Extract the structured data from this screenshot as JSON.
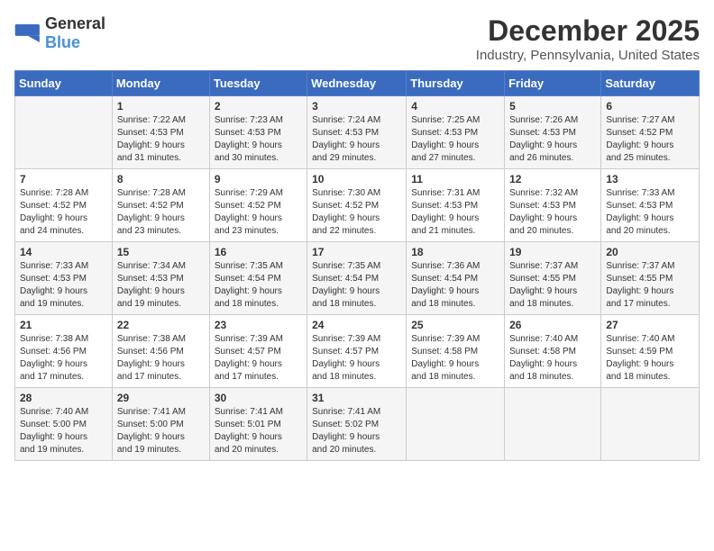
{
  "header": {
    "logo_general": "General",
    "logo_blue": "Blue",
    "month": "December 2025",
    "location": "Industry, Pennsylvania, United States"
  },
  "weekdays": [
    "Sunday",
    "Monday",
    "Tuesday",
    "Wednesday",
    "Thursday",
    "Friday",
    "Saturday"
  ],
  "weeks": [
    [
      {
        "num": "",
        "info": ""
      },
      {
        "num": "1",
        "info": "Sunrise: 7:22 AM\nSunset: 4:53 PM\nDaylight: 9 hours\nand 31 minutes."
      },
      {
        "num": "2",
        "info": "Sunrise: 7:23 AM\nSunset: 4:53 PM\nDaylight: 9 hours\nand 30 minutes."
      },
      {
        "num": "3",
        "info": "Sunrise: 7:24 AM\nSunset: 4:53 PM\nDaylight: 9 hours\nand 29 minutes."
      },
      {
        "num": "4",
        "info": "Sunrise: 7:25 AM\nSunset: 4:53 PM\nDaylight: 9 hours\nand 27 minutes."
      },
      {
        "num": "5",
        "info": "Sunrise: 7:26 AM\nSunset: 4:53 PM\nDaylight: 9 hours\nand 26 minutes."
      },
      {
        "num": "6",
        "info": "Sunrise: 7:27 AM\nSunset: 4:52 PM\nDaylight: 9 hours\nand 25 minutes."
      }
    ],
    [
      {
        "num": "7",
        "info": "Sunrise: 7:28 AM\nSunset: 4:52 PM\nDaylight: 9 hours\nand 24 minutes."
      },
      {
        "num": "8",
        "info": "Sunrise: 7:28 AM\nSunset: 4:52 PM\nDaylight: 9 hours\nand 23 minutes."
      },
      {
        "num": "9",
        "info": "Sunrise: 7:29 AM\nSunset: 4:52 PM\nDaylight: 9 hours\nand 23 minutes."
      },
      {
        "num": "10",
        "info": "Sunrise: 7:30 AM\nSunset: 4:52 PM\nDaylight: 9 hours\nand 22 minutes."
      },
      {
        "num": "11",
        "info": "Sunrise: 7:31 AM\nSunset: 4:53 PM\nDaylight: 9 hours\nand 21 minutes."
      },
      {
        "num": "12",
        "info": "Sunrise: 7:32 AM\nSunset: 4:53 PM\nDaylight: 9 hours\nand 20 minutes."
      },
      {
        "num": "13",
        "info": "Sunrise: 7:33 AM\nSunset: 4:53 PM\nDaylight: 9 hours\nand 20 minutes."
      }
    ],
    [
      {
        "num": "14",
        "info": "Sunrise: 7:33 AM\nSunset: 4:53 PM\nDaylight: 9 hours\nand 19 minutes."
      },
      {
        "num": "15",
        "info": "Sunrise: 7:34 AM\nSunset: 4:53 PM\nDaylight: 9 hours\nand 19 minutes."
      },
      {
        "num": "16",
        "info": "Sunrise: 7:35 AM\nSunset: 4:54 PM\nDaylight: 9 hours\nand 18 minutes."
      },
      {
        "num": "17",
        "info": "Sunrise: 7:35 AM\nSunset: 4:54 PM\nDaylight: 9 hours\nand 18 minutes."
      },
      {
        "num": "18",
        "info": "Sunrise: 7:36 AM\nSunset: 4:54 PM\nDaylight: 9 hours\nand 18 minutes."
      },
      {
        "num": "19",
        "info": "Sunrise: 7:37 AM\nSunset: 4:55 PM\nDaylight: 9 hours\nand 18 minutes."
      },
      {
        "num": "20",
        "info": "Sunrise: 7:37 AM\nSunset: 4:55 PM\nDaylight: 9 hours\nand 17 minutes."
      }
    ],
    [
      {
        "num": "21",
        "info": "Sunrise: 7:38 AM\nSunset: 4:56 PM\nDaylight: 9 hours\nand 17 minutes."
      },
      {
        "num": "22",
        "info": "Sunrise: 7:38 AM\nSunset: 4:56 PM\nDaylight: 9 hours\nand 17 minutes."
      },
      {
        "num": "23",
        "info": "Sunrise: 7:39 AM\nSunset: 4:57 PM\nDaylight: 9 hours\nand 17 minutes."
      },
      {
        "num": "24",
        "info": "Sunrise: 7:39 AM\nSunset: 4:57 PM\nDaylight: 9 hours\nand 18 minutes."
      },
      {
        "num": "25",
        "info": "Sunrise: 7:39 AM\nSunset: 4:58 PM\nDaylight: 9 hours\nand 18 minutes."
      },
      {
        "num": "26",
        "info": "Sunrise: 7:40 AM\nSunset: 4:58 PM\nDaylight: 9 hours\nand 18 minutes."
      },
      {
        "num": "27",
        "info": "Sunrise: 7:40 AM\nSunset: 4:59 PM\nDaylight: 9 hours\nand 18 minutes."
      }
    ],
    [
      {
        "num": "28",
        "info": "Sunrise: 7:40 AM\nSunset: 5:00 PM\nDaylight: 9 hours\nand 19 minutes."
      },
      {
        "num": "29",
        "info": "Sunrise: 7:41 AM\nSunset: 5:00 PM\nDaylight: 9 hours\nand 19 minutes."
      },
      {
        "num": "30",
        "info": "Sunrise: 7:41 AM\nSunset: 5:01 PM\nDaylight: 9 hours\nand 20 minutes."
      },
      {
        "num": "31",
        "info": "Sunrise: 7:41 AM\nSunset: 5:02 PM\nDaylight: 9 hours\nand 20 minutes."
      },
      {
        "num": "",
        "info": ""
      },
      {
        "num": "",
        "info": ""
      },
      {
        "num": "",
        "info": ""
      }
    ]
  ]
}
